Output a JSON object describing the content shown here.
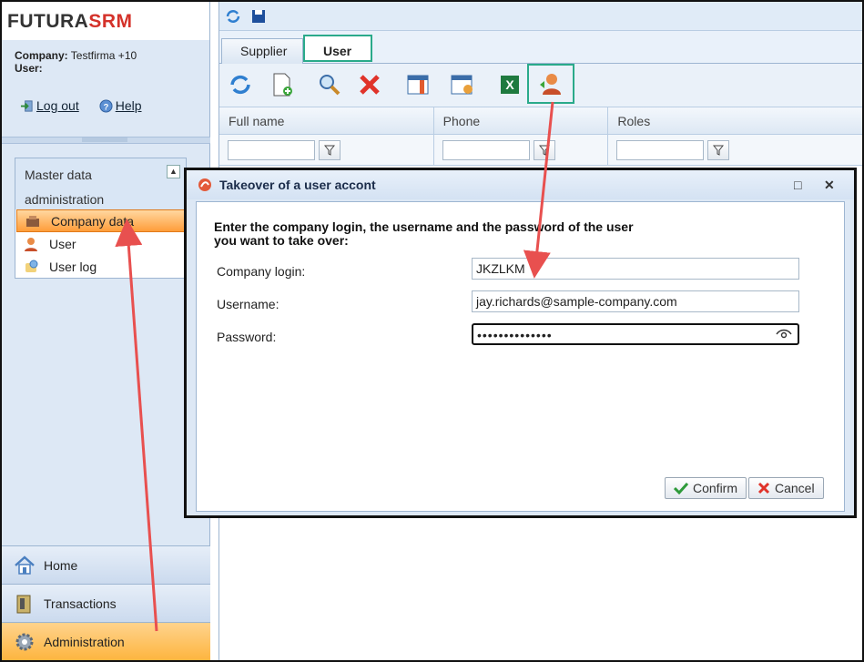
{
  "brand": {
    "part1": "FUTURA",
    "part2": "SRM"
  },
  "info": {
    "company_label": "Company:",
    "company_value": "Testfirma +10",
    "user_label": "User:"
  },
  "links": {
    "logout": "Log out",
    "help": "Help"
  },
  "navbox": {
    "header_line1": "Master data",
    "header_line2": "administration",
    "items": [
      {
        "label": "Company data",
        "icon": "company-data-icon"
      },
      {
        "label": "User",
        "icon": "user-icon"
      },
      {
        "label": "User log",
        "icon": "user-log-icon"
      }
    ]
  },
  "bottomnav": {
    "home": "Home",
    "transactions": "Transactions",
    "administration": "Administration"
  },
  "tabs": {
    "supplier": "Supplier",
    "user": "User"
  },
  "grid": {
    "columns": [
      "Full name",
      "Phone",
      "Roles"
    ]
  },
  "dialog": {
    "title": "Takeover of a user accont",
    "message": "Enter the company login, the username and the password of the user you want to take over:",
    "labels": {
      "company": "Company login:",
      "username": "Username:",
      "password": "Password:"
    },
    "values": {
      "company": "JKZLKM",
      "username": "jay.richards@sample-company.com",
      "password": "••••••••••••••"
    },
    "confirm": "Confirm",
    "cancel": "Cancel"
  },
  "colors": {
    "accent_highlight": "#2aaa8a",
    "active_nav": "#ff9d3a",
    "annotation_arrow": "#e8504f"
  }
}
